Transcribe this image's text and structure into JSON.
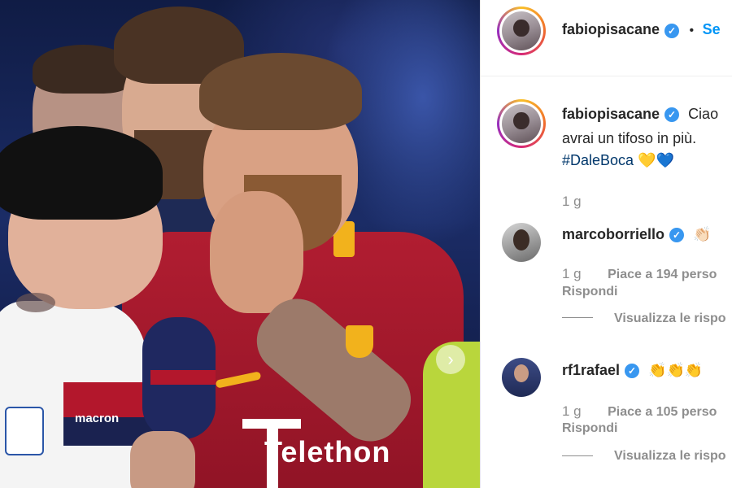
{
  "header": {
    "username": "fabiopisacane",
    "separator": "•",
    "follow_label": "Se"
  },
  "caption": {
    "username": "fabiopisacane",
    "text_line1": "Ciao",
    "text_line2": "avrai un tifoso in più.",
    "hashtag": "#DaleBoca",
    "emojis": "💛💙",
    "time": "1 g"
  },
  "comments": [
    {
      "username": "marcoborriello",
      "verified": true,
      "text": "👏🏻",
      "time": "1 g",
      "likes": "Piace a 194 perso",
      "reply": "Rispondi",
      "view_replies": "Visualizza le rispo"
    },
    {
      "username": "rf1rafael",
      "verified": true,
      "text": "👏👏👏",
      "time": "1 g",
      "likes": "Piace a 105 perso",
      "reply": "Rispondi",
      "view_replies": "Visualizza le rispo"
    }
  ],
  "photo": {
    "shirt_text": "Telethon",
    "kit_brand": "macron"
  },
  "colors": {
    "verified": "#3897f0",
    "roma_red": "#a3172b",
    "link": "#00376b"
  }
}
